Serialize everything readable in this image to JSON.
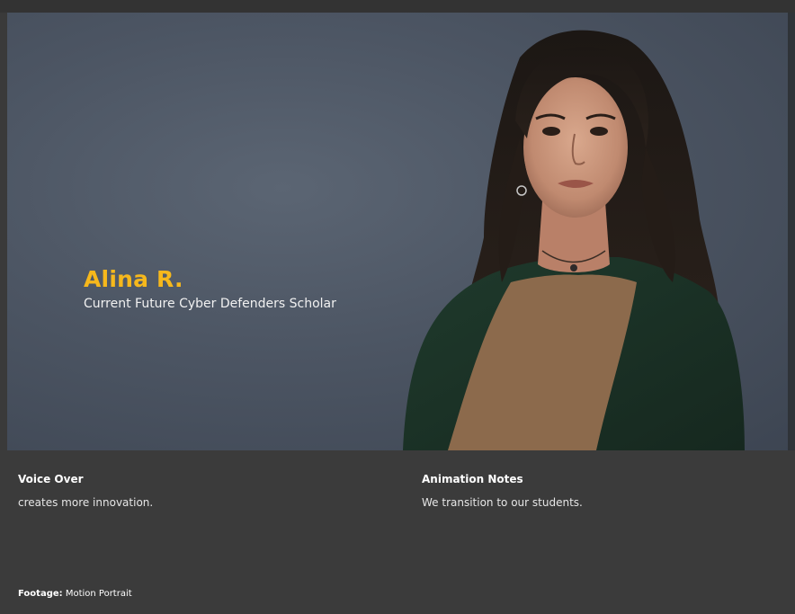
{
  "hero": {
    "name": "Alina R.",
    "subtitle": "Current Future Cyber Defenders Scholar",
    "accent_color": "#f6b81c",
    "portrait_icon": "woman-portrait-photo"
  },
  "voice_over": {
    "heading": "Voice Over",
    "text": "creates more innovation."
  },
  "animation_notes": {
    "heading": "Animation Notes",
    "text": "We transition to our students."
  },
  "footage": {
    "label": "Footage:",
    "value": "Motion Portrait"
  }
}
